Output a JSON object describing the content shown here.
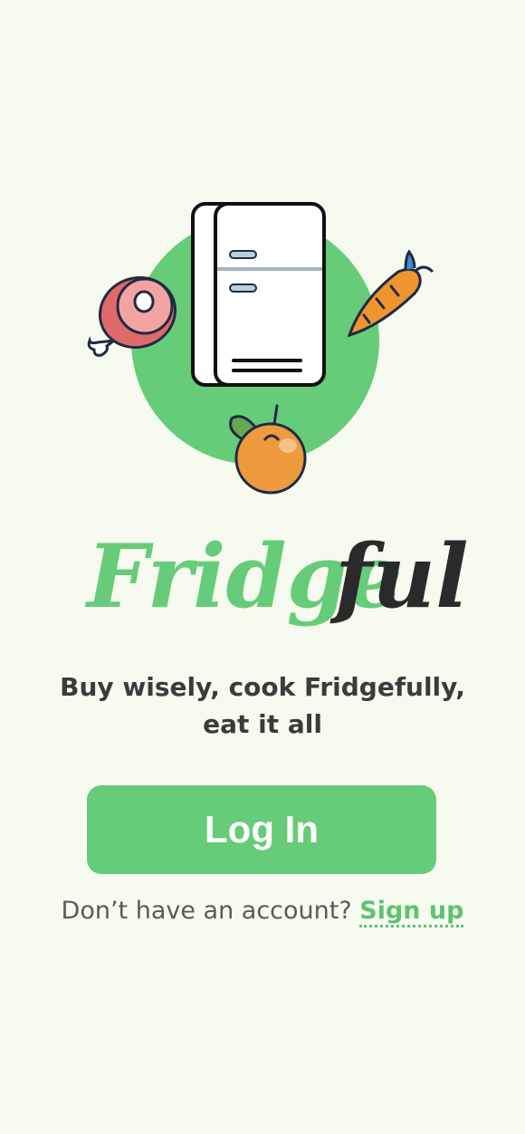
{
  "brand": {
    "name_part1": "Fridge",
    "name_part2": "ful",
    "accent_color": "#66cc79",
    "dark_color": "#2a2a2a"
  },
  "hero": {
    "icons": [
      "fridge-icon",
      "ham-icon",
      "carrot-icon",
      "orange-icon"
    ]
  },
  "tagline": {
    "line1": "Buy wisely, cook Fridgefully,",
    "line2": "eat it all"
  },
  "login": {
    "label": "Log In"
  },
  "signup": {
    "prompt": "Don’t have an account?",
    "link_label": "Sign up"
  }
}
